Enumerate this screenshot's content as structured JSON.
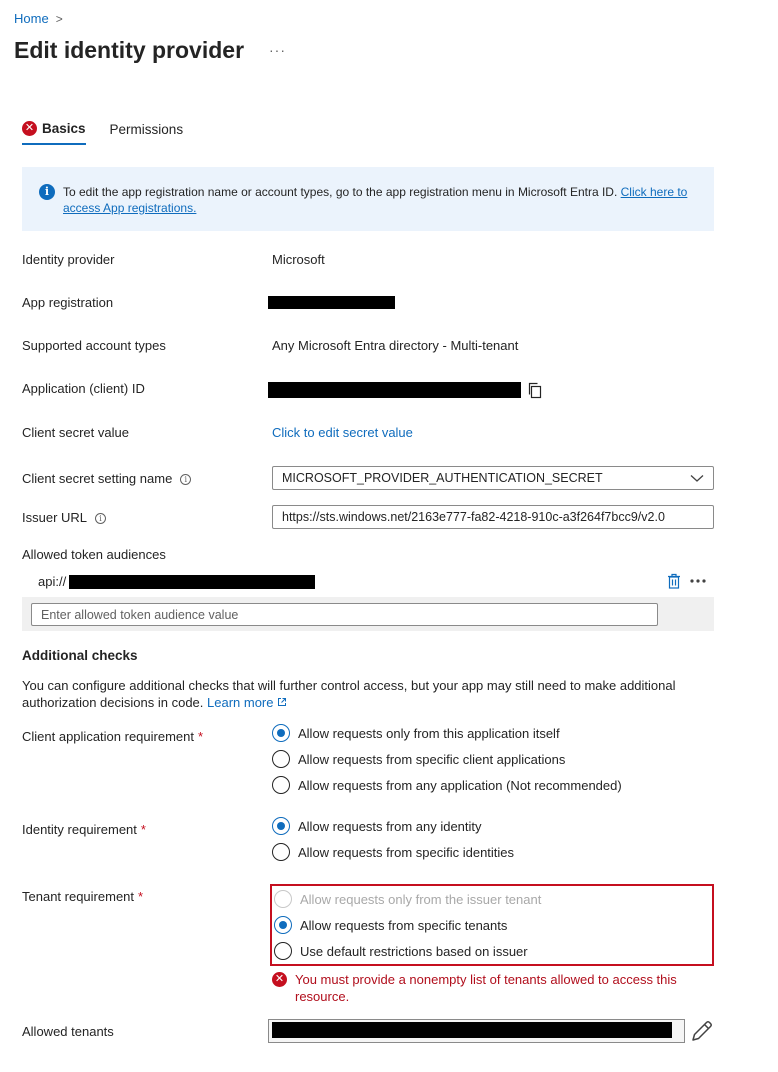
{
  "breadcrumb": {
    "home": "Home",
    "separator": ">"
  },
  "page": {
    "title": "Edit identity provider",
    "more_label": "···"
  },
  "tabs": [
    {
      "label": "Basics",
      "active": true,
      "has_error": true
    },
    {
      "label": "Permissions",
      "active": false,
      "has_error": false
    }
  ],
  "info_banner": {
    "icon": "info-icon",
    "text": "To edit the app registration name or account types, go to the app registration menu in Microsoft Entra ID. ",
    "link_text": "Click here to access App registrations."
  },
  "fields": {
    "identity_provider": {
      "label": "Identity provider",
      "value": "Microsoft"
    },
    "app_registration": {
      "label": "App registration"
    },
    "supported_account_types": {
      "label": "Supported account types",
      "value": "Any Microsoft Entra directory - Multi-tenant"
    },
    "application_client_id": {
      "label": "Application (client) ID"
    },
    "client_secret_value": {
      "label": "Client secret value",
      "link_text": "Click to edit secret value"
    },
    "client_secret_setting_name": {
      "label": "Client secret setting name",
      "value": "MICROSOFT_PROVIDER_AUTHENTICATION_SECRET",
      "help": "i"
    },
    "issuer_url": {
      "label": "Issuer URL",
      "value": "https://sts.windows.net/2163e777-fa82-4218-910c-a3f264f7bcc9/v2.0",
      "help": "i"
    },
    "allowed_token_audiences": {
      "label": "Allowed token audiences",
      "items": [
        {
          "prefix": "api://"
        }
      ],
      "new_placeholder": "Enter allowed token audience value"
    }
  },
  "additional_checks": {
    "heading": "Additional checks",
    "description": "You can configure additional checks that will further control access, but your app may still need to make additional authorization decisions in code. ",
    "learn_more": "Learn more",
    "required_mark": "*",
    "client_application_requirement": {
      "label": "Client application requirement",
      "options": [
        {
          "label": "Allow requests only from this application itself",
          "checked": true,
          "disabled": false
        },
        {
          "label": "Allow requests from specific client applications",
          "checked": false,
          "disabled": false
        },
        {
          "label": "Allow requests from any application (Not recommended)",
          "checked": false,
          "disabled": false
        }
      ]
    },
    "identity_requirement": {
      "label": "Identity requirement",
      "options": [
        {
          "label": "Allow requests from any identity",
          "checked": true,
          "disabled": false
        },
        {
          "label": "Allow requests from specific identities",
          "checked": false,
          "disabled": false
        }
      ]
    },
    "tenant_requirement": {
      "label": "Tenant requirement",
      "options": [
        {
          "label": "Allow requests only from the issuer tenant",
          "checked": false,
          "disabled": true
        },
        {
          "label": "Allow requests from specific tenants",
          "checked": true,
          "disabled": false
        },
        {
          "label": "Use default restrictions based on issuer",
          "checked": false,
          "disabled": false
        }
      ],
      "error": "You must provide a nonempty list of tenants allowed to access this resource."
    },
    "allowed_tenants": {
      "label": "Allowed tenants"
    }
  },
  "colors": {
    "accent": "#0f6cbd",
    "error": "#c50f1f",
    "info_bg": "#ebf3fc"
  }
}
